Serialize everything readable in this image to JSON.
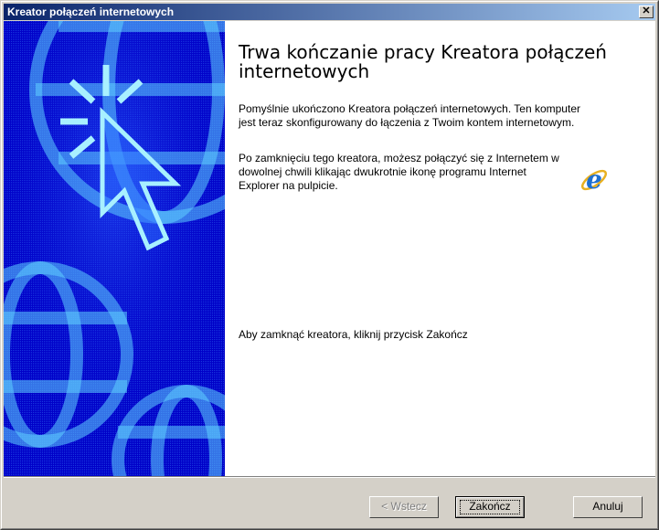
{
  "window": {
    "title": "Kreator połączeń internetowych"
  },
  "main": {
    "heading": "Trwa kończanie pracy Kreatora połączeń internetowych",
    "paragraph1": "Pomyślnie ukończono Kreatora połączeń internetowych. Ten komputer jest teraz skonfigurowany do łączenia z Twoim kontem internetowym.",
    "paragraph2": "Po zamknięciu tego kreatora, możesz połączyć się z Internetem w dowolnej chwili klikając dwukrotnie ikonę programu Internet Explorer na pulpicie.",
    "paragraph3": "Aby zamknąć kreatora, kliknij przycisk Zakończ",
    "icon": "internet-explorer-icon"
  },
  "buttons": {
    "back": "< Wstecz",
    "finish": "Zakończ",
    "cancel": "Anuluj"
  },
  "colors": {
    "title_start": "#0a246a",
    "title_end": "#a6caf0",
    "side_panel": "#0000c8"
  }
}
